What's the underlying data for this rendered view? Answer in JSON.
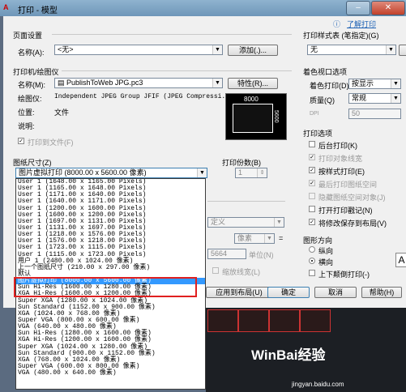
{
  "window": {
    "title": "打印 - 模型",
    "app_icon": "autocad-a-icon",
    "minimize_glyph": "–",
    "close_glyph": "✕"
  },
  "header": {
    "info_glyph": "ⓘ",
    "learn_link": "了解打印"
  },
  "page_setup": {
    "section": "页面设置",
    "name_label": "名称(A):",
    "name_value": "<无>",
    "add_button": "添加(.)..."
  },
  "printer": {
    "section": "打印机/绘图仪",
    "name_label": "名称(M):",
    "name_value": "PublishToWeb JPG.pc3",
    "properties_button": "特性(R)...",
    "plotter_label": "绘图仪:",
    "plotter_value": "Independent JPEG Group JFIF (JPEG Compressi...",
    "location_label": "位置:",
    "location_value": "文件",
    "description_label": "说明:",
    "print_to_file_label": "打印到文件(F)",
    "preview_width": "8000",
    "preview_height": "5600"
  },
  "paper_size": {
    "section": "图纸尺寸(Z)",
    "selected": "图片虚拟打印 (8000.00 x 5600.00 像素)",
    "options": [
      "User 1 (1648.00 x 1165.00 Pixels)",
      "User 1 (1165.00 x 1648.00 Pixels)",
      "User 1 (1171.00 x 1640.00 Pixels)",
      "User 1 (1640.00 x 1171.00 Pixels)",
      "User 1 (1200.00 x 1600.00 Pixels)",
      "User 1 (1600.00 x 1200.00 Pixels)",
      "User 1 (1697.00 x 1131.00 Pixels)",
      "User 1 (1131.00 x 1697.00 Pixels)",
      "User 1 (1218.00 x 1576.00 Pixels)",
      "User 1 (1576.00 x 1218.00 Pixels)",
      "User 1 (1723.00 x 1115.00 Pixels)",
      "User 1 (1115.00 x 1723.00 Pixels)",
      "用户 1 (2480.00 x 1024.00 像素)",
      "上一个图纸尺寸  (210.00 x 297.00 像素)",
      "默认",
      "图片虚拟打印 (8000.00 x 5600.00 像素)",
      "Sun Hi-Res (1600.00 x 1280.00 像素)",
      "XGA Hi-Res (1600.00 x 1200.00 像素)",
      "Super XGA (1280.00 x 1024.00 像素)",
      "Sun Standard (1152.00 x 900.00 像素)",
      "XGA (1024.00 x 768.00 像素)",
      "Super VGA (800.00 x 600.00 像素)",
      "VGA (640.00 x 480.00 像素)",
      "Sun Hi-Res (1280.00 x 1600.00 像素)",
      "XGA Hi-Res (1200.00 x 1600.00 像素)",
      "Super XGA (1024.00 x 1280.00 像素)",
      "Sun Standard (900.00 x 1152.00 像素)",
      "XGA (768.00 x 1024.00 像素)",
      "Super VGA (600.00 x 800.00 像素)",
      "VGA (480.00 x 640.00 像素)"
    ],
    "selected_index": 15
  },
  "copies": {
    "label": "打印份数(B)",
    "value": "1"
  },
  "behind_dropdown": {
    "plot_area_value": "定义",
    "scale_unit": "像素",
    "scale_value": "5664",
    "unit_label": "单位(N)",
    "lineweight_label": "缩放线宽(L)",
    "equals": "="
  },
  "plot_style_table": {
    "section": "打印样式表 (笔指定)(G)",
    "value": "无"
  },
  "shaded_viewport": {
    "section": "着色视口选项",
    "shade_label": "着色打印(D)",
    "shade_value": "按显示",
    "quality_label": "质量(Q)",
    "quality_value": "常规",
    "dpi_label": "DPI",
    "dpi_value": "50"
  },
  "plot_options": {
    "section": "打印选项",
    "items": [
      {
        "label": "后台打印(K)",
        "checked": false,
        "enabled": true
      },
      {
        "label": "打印对象线宽",
        "checked": true,
        "enabled": false
      },
      {
        "label": "按样式打印(E)",
        "checked": true,
        "enabled": true
      },
      {
        "label": "最后打印图纸空间",
        "checked": true,
        "enabled": false
      },
      {
        "label": "隐藏图纸空间对象(J)",
        "checked": false,
        "enabled": false
      },
      {
        "label": "打开打印戳记(N)",
        "checked": false,
        "enabled": true
      },
      {
        "label": "将修改保存到布局(V)",
        "checked": true,
        "enabled": true
      }
    ]
  },
  "orientation": {
    "section": "图形方向",
    "portrait": "纵向",
    "landscape": "横向",
    "selected": "landscape",
    "upside_down": "上下颠倒打印(-)",
    "orientation_glyph": "A"
  },
  "buttons": {
    "apply_layout": "应用到布局(U)",
    "ok": "确定",
    "cancel": "取消",
    "help": "帮助(H)"
  },
  "watermark": {
    "brand": "WinBai经验",
    "url": "jingyan.baidu.com"
  },
  "colors": {
    "selection": "#3399ff",
    "highlight_box": "#e02020"
  }
}
